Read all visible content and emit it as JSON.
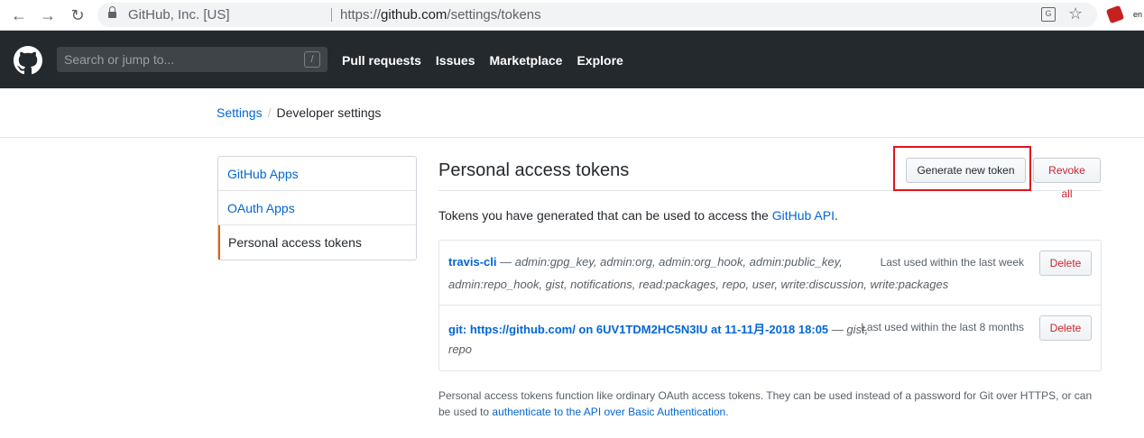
{
  "browser": {
    "site_identity": "GitHub, Inc. [US]",
    "url_prefix": "https://",
    "url_host": "github.com",
    "url_path": "/settings/tokens",
    "ext_label": "en"
  },
  "header": {
    "search_placeholder": "Search or jump to...",
    "search_shortcut": "/",
    "nav": [
      "Pull requests",
      "Issues",
      "Marketplace",
      "Explore"
    ]
  },
  "breadcrumb": {
    "root": "Settings",
    "separator": "/",
    "current": "Developer settings"
  },
  "sidebar": {
    "items": [
      {
        "label": "GitHub Apps"
      },
      {
        "label": "OAuth Apps"
      },
      {
        "label": "Personal access tokens"
      }
    ]
  },
  "main": {
    "title": "Personal access tokens",
    "generate_label": "Generate new token",
    "revoke_label": "Revoke all",
    "intro_text": "Tokens you have generated that can be used to access the ",
    "intro_link": "GitHub API",
    "intro_end": ".",
    "tokens": [
      {
        "name": "travis-cli",
        "dash": " — ",
        "scopes_line1": "admin:gpg_key, admin:org, admin:org_hook, admin:public_key,",
        "scopes_line2": "admin:repo_hook, gist, notifications, read:packages, repo, user, write:discussion, write:packages",
        "last_used": "Last used within the last week",
        "delete_label": "Delete"
      },
      {
        "name": "git: https://github.com/ on 6UV1TDM2HC5N3IU at 11-11月-2018 18:05",
        "dash": " — ",
        "scopes_line1": "gist,",
        "scopes_line2": "repo",
        "last_used": "Last used within the last 8 months",
        "delete_label": "Delete"
      }
    ],
    "footnote_text": "Personal access tokens function like ordinary OAuth access tokens. They can be used instead of a password for Git over HTTPS, or can be used to ",
    "footnote_link": "authenticate to the API over Basic Authentication",
    "footnote_end": "."
  },
  "colors": {
    "header_bg": "#24292e",
    "link": "#0366d6",
    "danger": "#cb2431",
    "highlight_box": "#e0141e"
  }
}
